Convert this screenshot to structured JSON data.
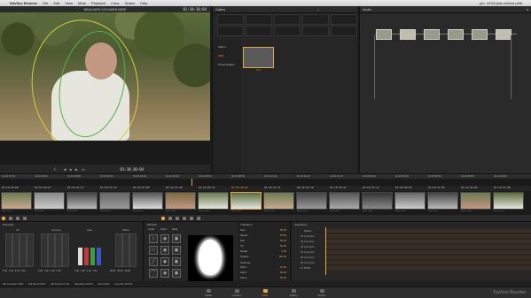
{
  "menubar": {
    "app": "DaVinci Resolve",
    "items": [
      "File",
      "Edit",
      "View",
      "Mark",
      "Playback",
      "Color",
      "Nodes",
      "Help"
    ],
    "status_right": "jeu. 19:55  jean-michel petit"
  },
  "viewer": {
    "project_name": "BEAUJARD DOCUMENTAIRE",
    "timecode_top": "01:10:30:04",
    "timecode_bottom": "01:10:30:04"
  },
  "gallery": {
    "title": "Gallery",
    "search": "",
    "albums": [
      "Stills 1",
      "Stills",
      "PowerGrades"
    ],
    "active_album": "Stills",
    "still_label": "1.1.1"
  },
  "nodes": {
    "title": "Nodes",
    "labels": [
      "01",
      "02",
      "03",
      "04",
      "05",
      "06",
      "07"
    ]
  },
  "timeline": {
    "ruler": [
      "01:10:17:00",
      "01:10:20:04",
      "01:10:23:08",
      "01:10:26:12",
      "01:10:29:16",
      "01:10:32:20",
      "01:10:35:24",
      "01:10:38:28",
      "01:10:41:32",
      "01:10:44:36",
      "01:10:47:40",
      "01:10:50:44",
      "01:10:53:48",
      "01:10:56:52",
      "01:10:59:56",
      "01:11:03:00"
    ],
    "clip_timecodes": [
      "01:10:19:06",
      "01:10:20:21",
      "01:10:21:17",
      "01:10:23:12",
      "01:10:27:06",
      "01:10:27:20",
      "01:10:29:12",
      "01:10:30:04",
      "01:10:31:11",
      "01:10:33:16",
      "01:10:36:21",
      "01:10:37:12",
      "01:10:38:25",
      "01:10:41:05",
      "01:10:44:02",
      "01:10:47:08"
    ],
    "clip_labels": [
      "A001 C004",
      "A001 C007",
      "A001 C010",
      "A001 C012",
      "A001 C015",
      "A001 C016",
      "A001 C018",
      "A001 C019",
      "A001 C022",
      "A001 C025",
      "A001 C027",
      "A001 C028",
      "A001 C031",
      "A001 C033",
      "A001 C036",
      "A001 C038"
    ]
  },
  "primaries": {
    "title": "Primaries",
    "wheels": [
      "Lift",
      "Gamma",
      "Gain",
      "Offset"
    ],
    "lift_values": [
      "0.00",
      "0.00",
      "0.00",
      "0.00"
    ],
    "gamma_values": [
      "0.00",
      "0.00",
      "0.00",
      "0.00"
    ],
    "gain_values": [
      "1.00",
      "1.00",
      "1.00",
      "1.00"
    ],
    "offset_values": [
      "25.00",
      "25.00",
      "25.00"
    ]
  },
  "window": {
    "title": "Window",
    "columns": [
      "Linear",
      "Invert",
      "Mask"
    ],
    "shapes": [
      "circle",
      "square",
      "linear",
      "polygon",
      "curve"
    ]
  },
  "transform": {
    "title": "Transform",
    "rows": [
      {
        "k": "Size",
        "v": "50.00"
      },
      {
        "k": "Aspect",
        "v": "50.00"
      },
      {
        "k": "Pan",
        "v": "50.00"
      },
      {
        "k": "Tilt",
        "v": "50.00"
      },
      {
        "k": "Rotate",
        "v": "0.00"
      },
      {
        "k": "Opacity",
        "v": "100.00"
      }
    ],
    "softness_title": "Softness",
    "softness_rows": [
      {
        "k": "Soft 1",
        "v": "12.00"
      },
      {
        "k": "Soft 2",
        "v": "50.00"
      },
      {
        "k": "Soft 3",
        "v": "50.00"
      },
      {
        "k": "Soft 4",
        "v": "50.00"
      }
    ]
  },
  "keyframes": {
    "title": "Keyframes",
    "tracks": [
      "Master",
      "01 Corrector",
      "02 Corrector",
      "03 Corrector",
      "04 Corrector",
      "05 Corrector",
      "06 Corrector",
      "07 PTZR"
    ]
  },
  "status": {
    "items": [
      "HR Contrast 1.000",
      "HR Bend 50.00",
      "HR Horizon 0.00",
      "Saturation 50.00",
      "Hue 50.00",
      "Lum Mix 100.00"
    ]
  },
  "pagebar": {
    "pages": [
      "Media",
      "Conform",
      "Color",
      "Gallery",
      "Deliver"
    ],
    "active": "Color",
    "brand": "DaVinci Resolve"
  },
  "colors": {
    "accent": "#e3a64a",
    "background": "#1e1e1e"
  }
}
